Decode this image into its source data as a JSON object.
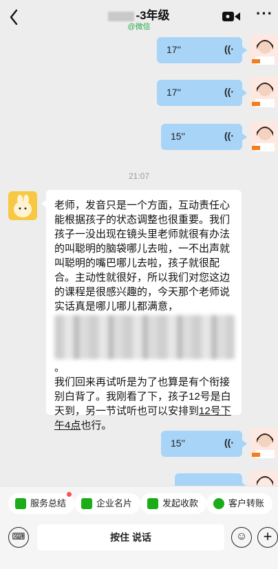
{
  "header": {
    "back": "<",
    "title_suffix": "-3年级",
    "subtitle": "@微信",
    "more": "···"
  },
  "messages_top": [
    {
      "duration": "17''",
      "wave": "((·"
    },
    {
      "duration": "17''",
      "wave": "((·"
    },
    {
      "duration": "15''",
      "wave": "((·"
    }
  ],
  "timestamp": "21:07",
  "text_message": {
    "part1": "老师，发音只是一个方面，互动责任心能根据孩子的状态调整也很重要。我们孩子一没出现在镜头里老师就很有办法的叫聪明的脑袋哪儿去啦，一不出声就叫聪明的嘴巴哪儿去啦，孩子就很配合。主动性就很好，所以我们对您这边的课程是很感兴趣的，今天那个老师说实话真是哪儿哪儿都满意，",
    "part2_tail": "。",
    "part3": "我们回来再试听是为了也算是有个衔接别白背了。我刚看了下，孩子12号是白天到，另一节试听也可以安排到",
    "part3_link": "12号下午4点",
    "part3_end": "也行。"
  },
  "messages_bottom": [
    {
      "duration": "15''",
      "wave": "((·"
    }
  ],
  "quick_actions": [
    {
      "label": "服务总结",
      "color": "#1aad19"
    },
    {
      "label": "企业名片",
      "color": "#1aad19"
    },
    {
      "label": "发起收款",
      "color": "#1aad19"
    },
    {
      "label": "客户转账",
      "color": "#1aad19"
    }
  ],
  "input": {
    "hold_to_talk": "按住 说话"
  }
}
